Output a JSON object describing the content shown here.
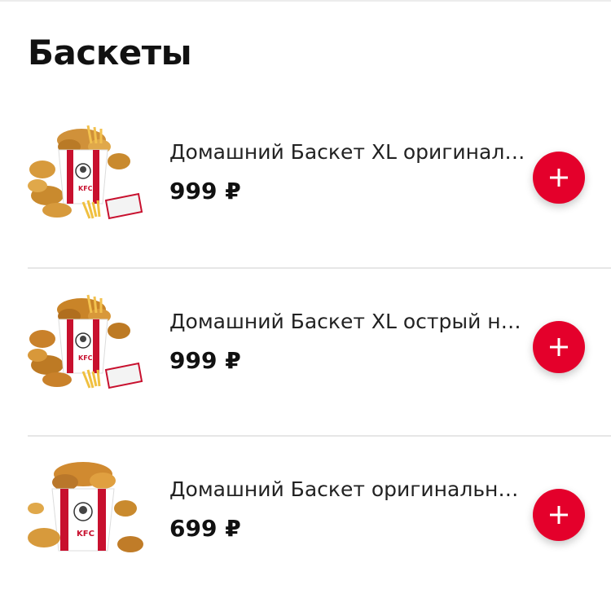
{
  "section": {
    "title": "Баскеты"
  },
  "colors": {
    "accent": "#e4002b",
    "divider": "#e6e6e6",
    "text": "#111111"
  },
  "products": [
    {
      "name": "Домашний Баскет XL оригиналь...",
      "price": "999 ₽",
      "image_icon": "kfc-basket-xl-image",
      "add_icon": "plus-icon"
    },
    {
      "name": "Домашний Баскет XL острый но...",
      "price": "999 ₽",
      "image_icon": "kfc-basket-xl-spicy-image",
      "add_icon": "plus-icon"
    },
    {
      "name": "Домашний Баскет оригинальны...",
      "price": "699 ₽",
      "image_icon": "kfc-basket-image",
      "add_icon": "plus-icon"
    }
  ]
}
